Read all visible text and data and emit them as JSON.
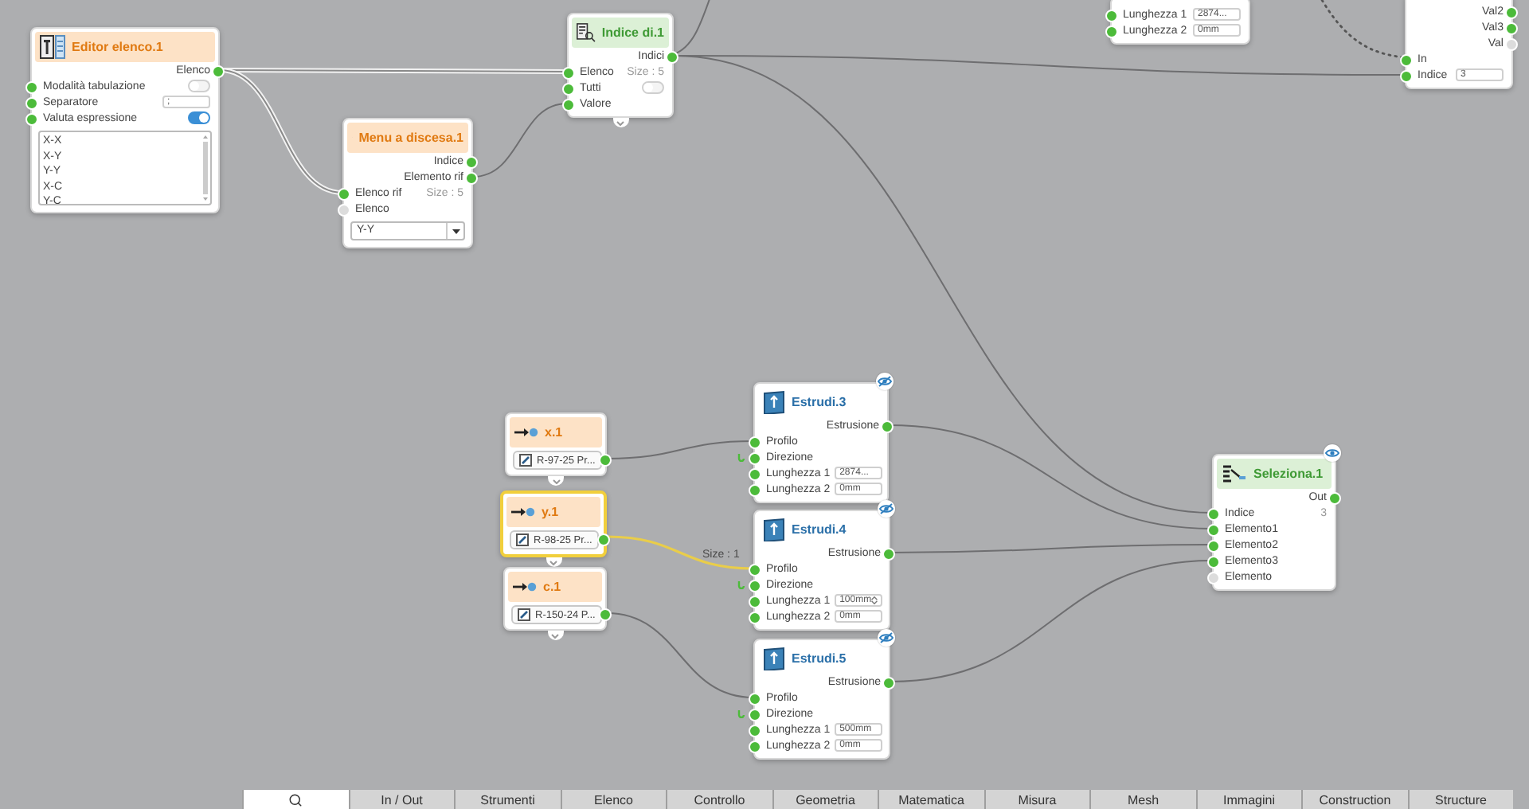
{
  "canvas": {
    "nodes": [
      {
        "kind": "partial",
        "selected": false,
        "rows": [
          {
            "kind": "in",
            "label": "Lunghezza 1",
            "connected": true,
            "value": "2874..."
          },
          {
            "kind": "in",
            "label": "Lunghezza 2",
            "connected": true,
            "value": "0mm"
          }
        ]
      },
      {
        "kind": "partial",
        "selected": false,
        "rows": [
          {
            "kind": "out",
            "label": "Val2",
            "connected": true
          },
          {
            "kind": "out",
            "label": "Val3",
            "connected": true
          },
          {
            "kind": "out",
            "label": "Val",
            "connected": false
          },
          {
            "kind": "in",
            "label": "In",
            "connected": true
          },
          {
            "kind": "in",
            "label": "Indice",
            "connected": true,
            "value": "3"
          }
        ]
      },
      {
        "kind": "list_editor",
        "title": "Editor elenco.1",
        "selected": false,
        "rows": [
          {
            "kind": "out",
            "label": "Elenco",
            "connected": true
          },
          {
            "kind": "in",
            "label": "Modalità tabulazione",
            "connected": true,
            "on": false
          },
          {
            "kind": "in",
            "label": "Separatore",
            "connected": true,
            "value": ";"
          },
          {
            "kind": "in",
            "label": "Valuta espressione",
            "connected": true,
            "on": true
          },
          {
            "kind": "list",
            "items": [
              "X-X",
              "X-Y",
              "Y-Y",
              "X-C",
              "Y-C"
            ]
          }
        ]
      },
      {
        "kind": "index_of",
        "title": "Indice di.1",
        "selected": false,
        "rows": [
          {
            "kind": "out",
            "label": "Indici",
            "connected": true
          },
          {
            "kind": "in",
            "label": "Elenco",
            "connected": true,
            "info": "Size : 5"
          },
          {
            "kind": "in",
            "label": "Tutti",
            "connected": true,
            "on": false
          },
          {
            "kind": "in",
            "label": "Valore",
            "connected": true
          }
        ]
      },
      {
        "kind": "dropdown",
        "title": "Menu a discesa.1",
        "selected": false,
        "rows": [
          {
            "kind": "out",
            "label": "Indice",
            "connected": true
          },
          {
            "kind": "out",
            "label": "Elemento rif",
            "connected": true
          },
          {
            "kind": "in",
            "label": "Elenco rif",
            "connected": true,
            "info": "Size : 5"
          },
          {
            "kind": "in",
            "label": "Elenco",
            "connected": false
          },
          {
            "kind": "select",
            "value": "Y-Y"
          }
        ]
      },
      {
        "kind": "input",
        "title": "x.1",
        "selected": false,
        "rows": [
          {
            "kind": "field",
            "value": "R-97-25 Pr..."
          }
        ]
      },
      {
        "kind": "input",
        "title": "y.1",
        "selected": true,
        "wire_label": "Size : 1",
        "rows": [
          {
            "kind": "field",
            "value": "R-98-25 Pr..."
          }
        ]
      },
      {
        "kind": "input",
        "title": "c.1",
        "selected": false,
        "rows": [
          {
            "kind": "field",
            "value": "R-150-24 P..."
          }
        ]
      },
      {
        "kind": "extrude",
        "title": "Estrudi.3",
        "selected": false,
        "preview": false,
        "rows": [
          {
            "kind": "out",
            "label": "Estrusione",
            "connected": true
          },
          {
            "kind": "in",
            "label": "Profilo",
            "connected": true
          },
          {
            "kind": "direction",
            "label": "Direzione",
            "connected": true
          },
          {
            "kind": "in",
            "label": "Lunghezza 1",
            "connected": true,
            "value": "2874..."
          },
          {
            "kind": "in",
            "label": "Lunghezza 2",
            "connected": true,
            "value": "0mm"
          }
        ]
      },
      {
        "kind": "extrude",
        "title": "Estrudi.4",
        "selected": false,
        "preview": false,
        "rows": [
          {
            "kind": "out",
            "label": "Estrusione",
            "connected": true
          },
          {
            "kind": "in",
            "label": "Profilo",
            "connected": true
          },
          {
            "kind": "direction",
            "label": "Direzione",
            "connected": true
          },
          {
            "kind": "in",
            "label": "Lunghezza 1",
            "connected": true,
            "value": "100mm",
            "stepper": true
          },
          {
            "kind": "in",
            "label": "Lunghezza 2",
            "connected": true,
            "value": "0mm"
          }
        ]
      },
      {
        "kind": "extrude",
        "title": "Estrudi.5",
        "selected": false,
        "preview": false,
        "rows": [
          {
            "kind": "out",
            "label": "Estrusione",
            "connected": true
          },
          {
            "kind": "in",
            "label": "Profilo",
            "connected": true
          },
          {
            "kind": "direction",
            "label": "Direzione",
            "connected": true
          },
          {
            "kind": "in",
            "label": "Lunghezza 1",
            "connected": true,
            "value": "500mm"
          },
          {
            "kind": "in",
            "label": "Lunghezza 2",
            "connected": true,
            "value": "0mm"
          }
        ]
      },
      {
        "kind": "select_node",
        "title": "Seleziona.1",
        "selected": false,
        "preview": true,
        "rows": [
          {
            "kind": "out",
            "label": "Out",
            "connected": true
          },
          {
            "kind": "in",
            "label": "Indice",
            "connected": true,
            "info": "3"
          },
          {
            "kind": "in",
            "label": "Elemento1",
            "connected": true
          },
          {
            "kind": "in",
            "label": "Elemento2",
            "connected": true
          },
          {
            "kind": "in",
            "label": "Elemento3",
            "connected": true
          },
          {
            "kind": "in",
            "label": "Elemento",
            "connected": false
          }
        ]
      }
    ]
  },
  "tabs": [
    {
      "kind": "search",
      "selected": true
    },
    {
      "label": "In / Out",
      "selected": false
    },
    {
      "label": "Strumenti",
      "selected": false
    },
    {
      "label": "Elenco",
      "selected": false
    },
    {
      "label": "Controllo",
      "selected": false
    },
    {
      "label": "Geometria",
      "selected": false
    },
    {
      "label": "Matematica",
      "selected": false
    },
    {
      "label": "Misura",
      "selected": false
    },
    {
      "label": "Mesh",
      "selected": false
    },
    {
      "label": "Immagini",
      "selected": false
    },
    {
      "label": "Construction",
      "selected": false
    },
    {
      "label": "Structure",
      "selected": false
    }
  ]
}
